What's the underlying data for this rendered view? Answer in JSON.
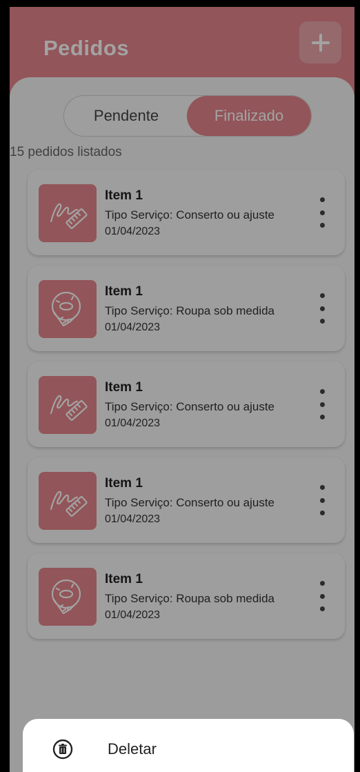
{
  "header": {
    "title": "Pedidos",
    "add_icon": "plus-icon"
  },
  "tabs": {
    "pending_label": "Pendente",
    "finished_label": "Finalizado",
    "selected": "Finalizado"
  },
  "list": {
    "count_label": "15 pedidos listados",
    "items": [
      {
        "name": "Item 1",
        "type": "Tipo Serviço: Conserto ou ajuste",
        "date": "01/04/2023",
        "icon": "needle-thread-icon"
      },
      {
        "name": "Item 1",
        "type": "Tipo Serviço: Roupa sob medida",
        "date": "01/04/2023",
        "icon": "measuring-tape-icon"
      },
      {
        "name": "Item 1",
        "type": "Tipo Serviço: Conserto ou ajuste",
        "date": "01/04/2023",
        "icon": "needle-thread-icon"
      },
      {
        "name": "Item 1",
        "type": "Tipo Serviço: Conserto ou ajuste",
        "date": "01/04/2023",
        "icon": "needle-thread-icon"
      },
      {
        "name": "Item 1",
        "type": "Tipo Serviço: Roupa sob medida",
        "date": "01/04/2023",
        "icon": "measuring-tape-icon"
      }
    ]
  },
  "bottom_sheet": {
    "delete_label": "Deletar",
    "delete_icon": "trash-icon"
  },
  "colors": {
    "accent": "#e4868b",
    "background": "#f4f4f4"
  }
}
